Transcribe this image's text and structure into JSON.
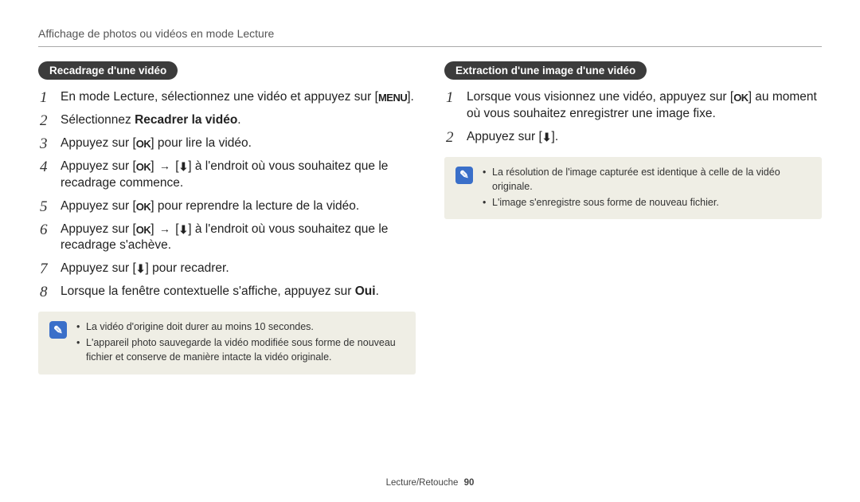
{
  "header": {
    "breadcrumb": "Affichage de photos ou vidéos en mode Lecture"
  },
  "icons": {
    "menu": "MENU",
    "ok": "OK",
    "download": "⬇",
    "arrow": "→",
    "note": "✎"
  },
  "left": {
    "title": "Recadrage d'une vidéo",
    "steps": {
      "s1a": "En mode Lecture, sélectionnez une vidéo et appuyez sur [",
      "s1b": "].",
      "s2a": "Sélectionnez ",
      "s2b": "Recadrer la vidéo",
      "s2c": ".",
      "s3a": "Appuyez sur [",
      "s3b": "] pour lire la vidéo.",
      "s4a": "Appuyez sur [",
      "s4b": "] ",
      "s4c": " [",
      "s4d": "] à l'endroit où vous souhaitez que le recadrage commence.",
      "s5a": "Appuyez sur [",
      "s5b": "] pour reprendre la lecture de la vidéo.",
      "s6a": "Appuyez sur [",
      "s6b": "] ",
      "s6c": " [",
      "s6d": "] à l'endroit où vous souhaitez que le recadrage s'achève.",
      "s7a": "Appuyez sur [",
      "s7b": "] pour recadrer.",
      "s8a": "Lorsque la fenêtre contextuelle s'affiche, appuyez sur ",
      "s8b": "Oui",
      "s8c": "."
    },
    "note": {
      "n1": "La vidéo d'origine doit durer au moins 10 secondes.",
      "n2": "L'appareil photo sauvegarde la vidéo modifiée sous forme de nouveau fichier et conserve de manière intacte la vidéo originale."
    }
  },
  "right": {
    "title": "Extraction d'une image d'une vidéo",
    "steps": {
      "s1a": "Lorsque vous visionnez une vidéo, appuyez sur [",
      "s1b": "] au moment où vous souhaitez enregistrer une image fixe.",
      "s2a": "Appuyez sur [",
      "s2b": "]."
    },
    "note": {
      "n1": "La résolution de l'image capturée est identique à celle de la vidéo originale.",
      "n2": "L'image s'enregistre sous forme de nouveau fichier."
    }
  },
  "footer": {
    "section": "Lecture/Retouche",
    "page": "90"
  }
}
